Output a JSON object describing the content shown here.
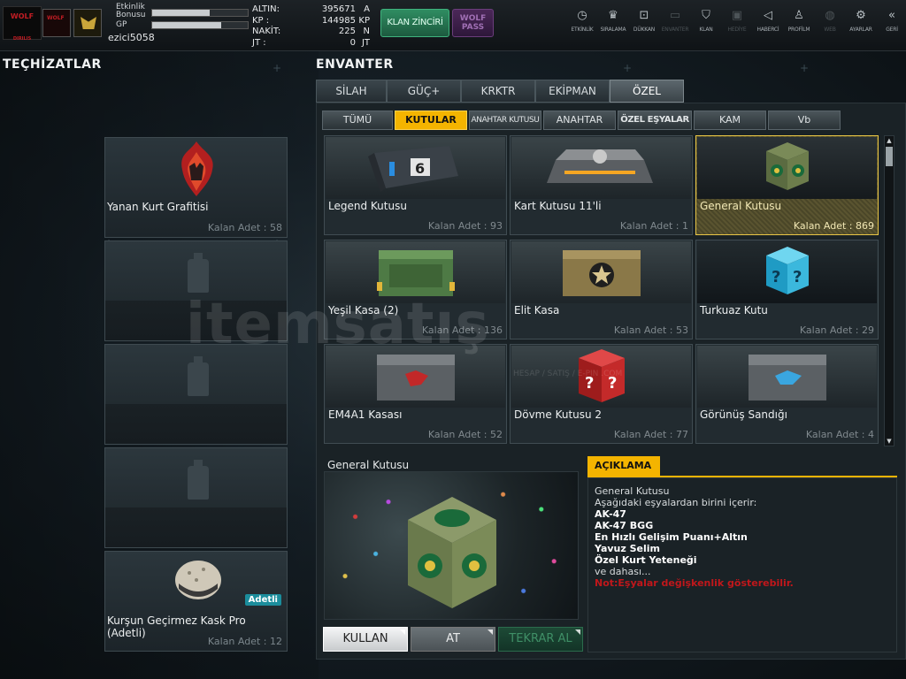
{
  "topbar": {
    "logo_text": "WOLF",
    "logo_sub": "DIRILIS",
    "emblem_text": "WOLF",
    "bonus_label": "Etkinlik Bonusu",
    "bonus_fill": 0.6,
    "gp_label": "GP",
    "gp_fill": 0.72,
    "username": "ezici5058",
    "currencies": [
      {
        "key": "ALTIN:",
        "value": "395671",
        "unit": "A"
      },
      {
        "key": "KP :",
        "value": "144985",
        "unit": "KP"
      },
      {
        "key": "NAKİT:",
        "value": "225",
        "unit": "N"
      },
      {
        "key": "JT :",
        "value": "0",
        "unit": "JT"
      }
    ],
    "klan_button": "KLAN ZİNCİRİ",
    "wolf_pass_button": "WOLF PASS",
    "nav": [
      {
        "label": "ETKİNLİK",
        "icon": "stopwatch-icon",
        "glyph": "◷"
      },
      {
        "label": "SIRALAMA",
        "icon": "rank-icon",
        "glyph": "♛"
      },
      {
        "label": "DÜKKAN",
        "icon": "cart-icon",
        "glyph": "⊡"
      },
      {
        "label": "ENVANTER",
        "icon": "inventory-icon",
        "glyph": "▭"
      },
      {
        "label": "KLAN",
        "icon": "shield-icon",
        "glyph": "⛉"
      },
      {
        "label": "HEDİYE",
        "icon": "gift-icon",
        "glyph": "▣"
      },
      {
        "label": "HABERCİ",
        "icon": "megaphone-icon",
        "glyph": "◁"
      },
      {
        "label": "PROFİLM",
        "icon": "profile-icon",
        "glyph": "♙"
      },
      {
        "label": "WEB",
        "icon": "globe-icon",
        "glyph": "◍"
      },
      {
        "label": "AYARLAR",
        "icon": "gear-icon",
        "glyph": "⚙"
      },
      {
        "label": "GERİ",
        "icon": "back-icon",
        "glyph": "«"
      }
    ]
  },
  "equipment": {
    "title": "TEÇHİZATLAR",
    "slots": [
      {
        "name": "Yanan Kurt Grafitisi",
        "count": "Kalan Adet : 58"
      },
      {
        "name": "",
        "count": ""
      },
      {
        "name": "",
        "count": ""
      },
      {
        "name": "",
        "count": ""
      },
      {
        "name": "Kurşun Geçirmez Kask Pro (Adetli)",
        "count": "Kalan Adet : 12",
        "badge": "Adetli"
      }
    ]
  },
  "inventory": {
    "title": "ENVANTER",
    "tabs": [
      "SİLAH",
      "GÜÇ+",
      "KRKTR",
      "EKİPMAN",
      "ÖZEL"
    ],
    "subtabs": [
      "TÜMÜ",
      "KUTULAR",
      "ANAHTAR KUTUSU",
      "ANAHTAR",
      "ÖZEL EŞYALAR",
      "KAM",
      "Vb"
    ],
    "items": [
      {
        "name": "Legend Kutusu",
        "count": "Kalan Adet : 93"
      },
      {
        "name": "Kart Kutusu 11'li",
        "count": "Kalan Adet : 1"
      },
      {
        "name": "General Kutusu",
        "count": "Kalan Adet : 869"
      },
      {
        "name": "Yeşil Kasa (2)",
        "count": "Kalan Adet : 136"
      },
      {
        "name": "Elit Kasa",
        "count": "Kalan Adet : 53"
      },
      {
        "name": "Turkuaz Kutu",
        "count": "Kalan Adet : 29"
      },
      {
        "name": "EM4A1 Kasası",
        "count": "Kalan Adet : 52"
      },
      {
        "name": "Dövme Kutusu 2",
        "count": "Kalan Adet : 77"
      },
      {
        "name": "Görünüş Sandığı",
        "count": "Kalan Adet : 4"
      }
    ]
  },
  "detail": {
    "title": "General Kutusu",
    "desc_head": "AÇIKLAMA",
    "line1": "General Kutusu",
    "line2": "Aşağıdaki eşyalardan birini içerir:",
    "bold_items": [
      "AK-47",
      "AK-47 BGG",
      "En Hızlı Gelişim Puanı+Altın",
      "Yavuz Selim",
      "Özel Kurt Yeteneği"
    ],
    "more": "ve dahası...",
    "note": "Not:Eşyalar değişkenlik gösterebilir.",
    "buttons": {
      "use": "KULLAN",
      "drop": "AT",
      "repeat": "TEKRAR AL"
    }
  },
  "watermark": {
    "text": "itemsatış",
    "sub": "HESAP / SATIŞ / E-PIN .COM"
  }
}
